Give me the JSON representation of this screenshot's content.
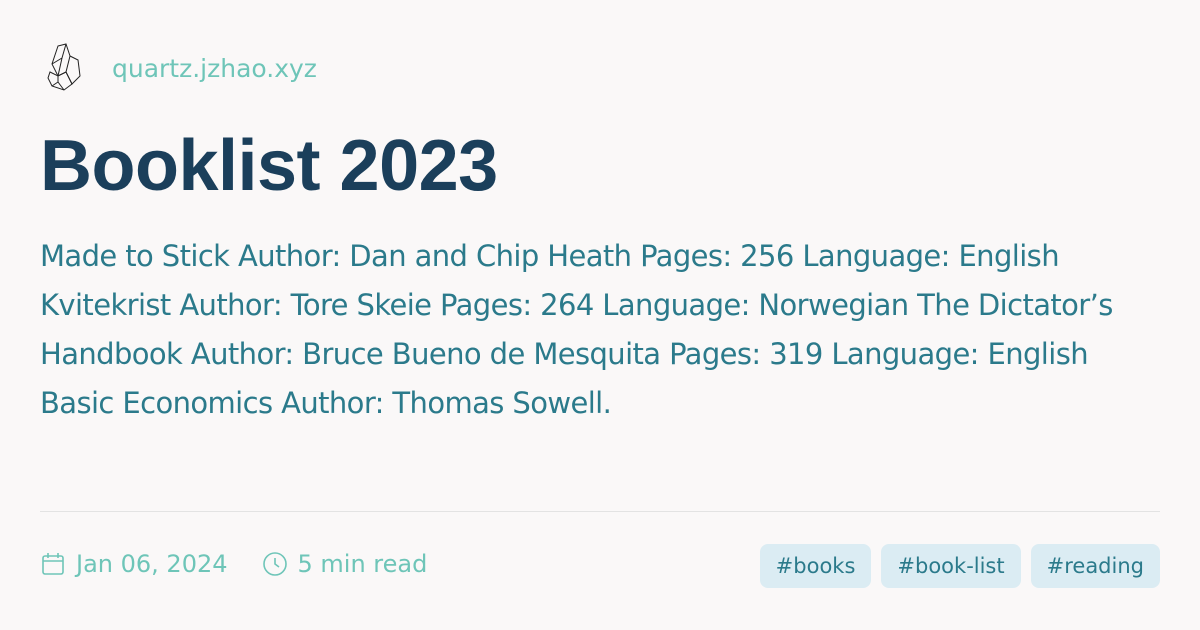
{
  "site": {
    "domain": "quartz.jzhao.xyz",
    "logo_icon": "quartz-crystal-icon"
  },
  "page": {
    "title": "Booklist 2023",
    "description": "Made to Stick Author: Dan and Chip Heath Pages: 256 Language: English Kvitekrist Author: Tore Skeie Pages: 264 Language: Norwegian The Dictator’s Handbook Author: Bruce Bueno de Mesquita Pages: 319 Language: English Basic Economics Author: Thomas Sowell."
  },
  "meta": {
    "date": "Jan 06, 2024",
    "reading_time": "5 min read"
  },
  "tags": [
    "#books",
    "#book-list",
    "#reading"
  ],
  "colors": {
    "accent": "#6ec5b8",
    "title": "#1b3f5b",
    "text": "#2b7a8b",
    "tag_bg": "#dbecf3"
  }
}
